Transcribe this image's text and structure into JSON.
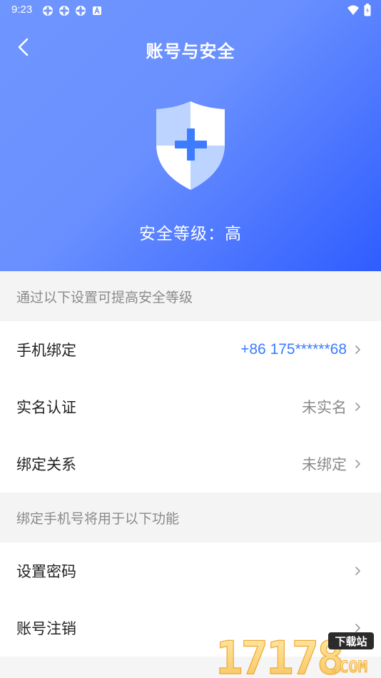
{
  "status": {
    "time": "9:23"
  },
  "header": {
    "title": "账号与安全",
    "security_level": "安全等级：高"
  },
  "section1": {
    "title": "通过以下设置可提高安全等级",
    "rows": [
      {
        "label": "手机绑定",
        "value": "+86  175******68"
      },
      {
        "label": "实名认证",
        "value": "未实名"
      },
      {
        "label": "绑定关系",
        "value": "未绑定"
      }
    ]
  },
  "section2": {
    "title": "绑定手机号将用于以下功能",
    "rows": [
      {
        "label": "设置密码"
      },
      {
        "label": "账号注销"
      }
    ]
  },
  "watermark": {
    "number": "17178",
    "badge": "下载站",
    "suffix": ".COM"
  },
  "colors": {
    "accent": "#3a7bff",
    "hero_start": "#6f95ff",
    "hero_end": "#2f5cff"
  },
  "icons": [
    "back-arrow-icon",
    "shield-plus-icon",
    "chevron-right-icon",
    "wifi-icon",
    "battery-icon"
  ]
}
